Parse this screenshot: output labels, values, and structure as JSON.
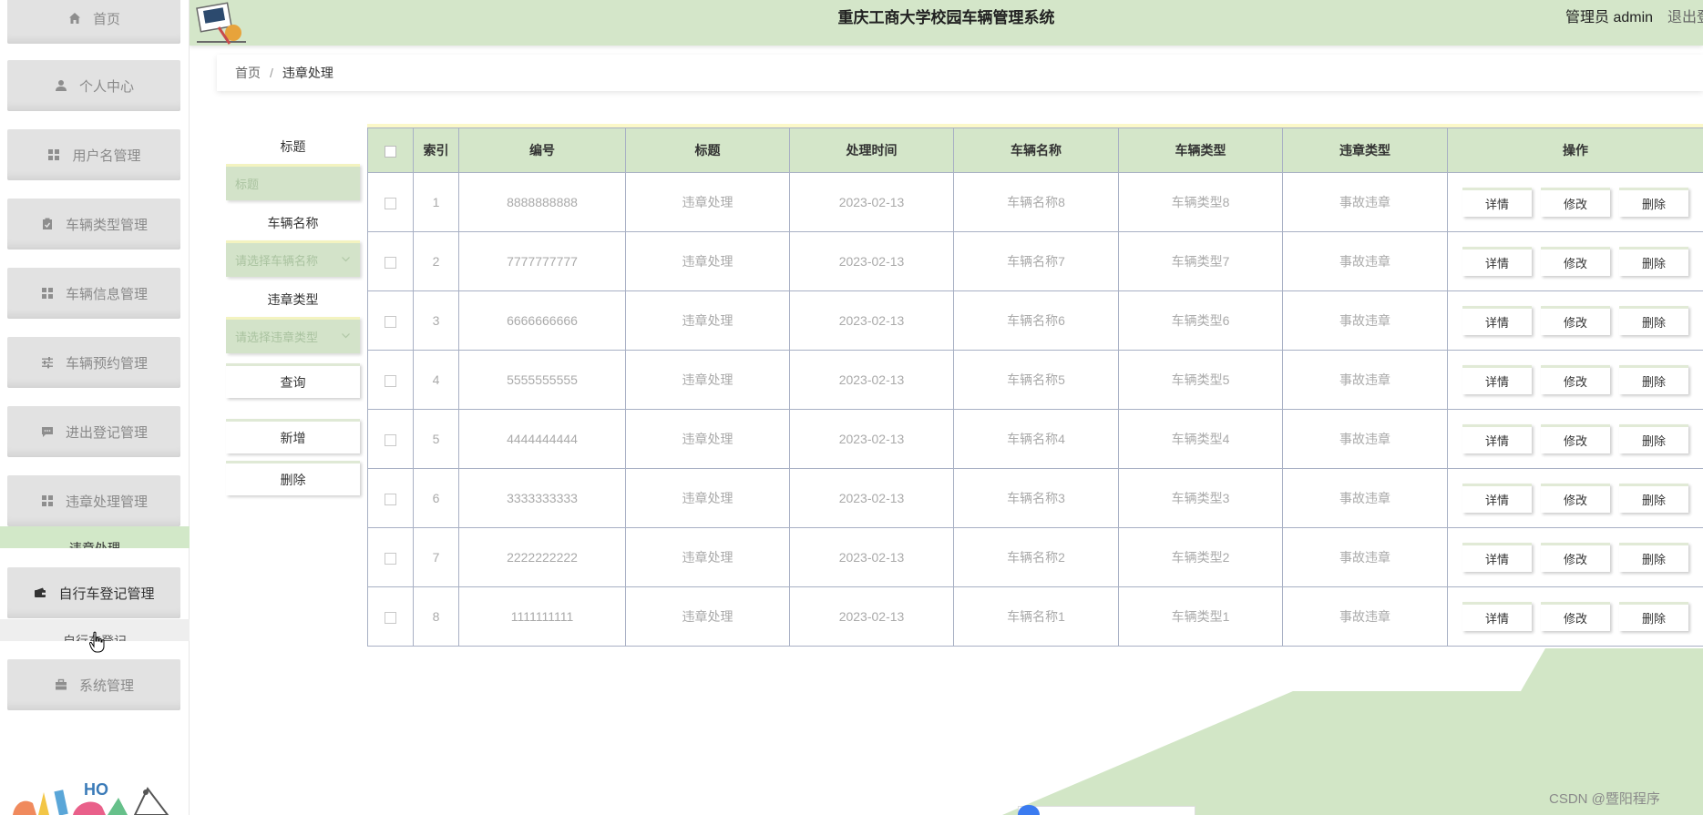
{
  "app": {
    "title": "重庆工商大学校园车辆管理系统",
    "user": "管理员 admin",
    "logout": "退出登"
  },
  "sidebar": {
    "items": [
      {
        "label": "首页",
        "icon": "home-icon"
      },
      {
        "label": "个人中心",
        "icon": "person-icon"
      },
      {
        "label": "用户名管理",
        "icon": "grid-icon"
      },
      {
        "label": "车辆类型管理",
        "icon": "clipboard-icon"
      },
      {
        "label": "车辆信息管理",
        "icon": "grid-icon"
      },
      {
        "label": "车辆预约管理",
        "icon": "sliders-icon"
      },
      {
        "label": "进出登记管理",
        "icon": "chat-icon"
      },
      {
        "label": "违章处理管理",
        "icon": "grid-icon"
      },
      {
        "label": "自行车登记管理",
        "icon": "wallet-icon"
      },
      {
        "label": "系统管理",
        "icon": "briefcase-icon"
      }
    ],
    "subitems": [
      {
        "label": "违章处理"
      },
      {
        "label": "自行车登记"
      }
    ]
  },
  "breadcrumb": {
    "home": "首页",
    "separator": "/",
    "current": "违章处理"
  },
  "search": {
    "title_label": "标题",
    "title_placeholder": "标题",
    "vehicle_name_label": "车辆名称",
    "vehicle_name_placeholder": "请选择车辆名称",
    "violation_type_label": "违章类型",
    "violation_type_placeholder": "请选择违章类型",
    "query_button": "查询",
    "add_button": "新增",
    "delete_button": "删除"
  },
  "table": {
    "columns": [
      "索引",
      "编号",
      "标题",
      "处理时间",
      "车辆名称",
      "车辆类型",
      "违章类型",
      "操作"
    ],
    "rows": [
      {
        "index": "1",
        "number": "8888888888",
        "title": "违章处理",
        "time": "2023-02-13",
        "vehicle_name": "车辆名称8",
        "vehicle_type": "车辆类型8",
        "violation_type": "事故违章"
      },
      {
        "index": "2",
        "number": "7777777777",
        "title": "违章处理",
        "time": "2023-02-13",
        "vehicle_name": "车辆名称7",
        "vehicle_type": "车辆类型7",
        "violation_type": "事故违章"
      },
      {
        "index": "3",
        "number": "6666666666",
        "title": "违章处理",
        "time": "2023-02-13",
        "vehicle_name": "车辆名称6",
        "vehicle_type": "车辆类型6",
        "violation_type": "事故违章"
      },
      {
        "index": "4",
        "number": "5555555555",
        "title": "违章处理",
        "time": "2023-02-13",
        "vehicle_name": "车辆名称5",
        "vehicle_type": "车辆类型5",
        "violation_type": "事故违章"
      },
      {
        "index": "5",
        "number": "4444444444",
        "title": "违章处理",
        "time": "2023-02-13",
        "vehicle_name": "车辆名称4",
        "vehicle_type": "车辆类型4",
        "violation_type": "事故违章"
      },
      {
        "index": "6",
        "number": "3333333333",
        "title": "违章处理",
        "time": "2023-02-13",
        "vehicle_name": "车辆名称3",
        "vehicle_type": "车辆类型3",
        "violation_type": "事故违章"
      },
      {
        "index": "7",
        "number": "2222222222",
        "title": "违章处理",
        "time": "2023-02-13",
        "vehicle_name": "车辆名称2",
        "vehicle_type": "车辆类型2",
        "violation_type": "事故违章"
      },
      {
        "index": "8",
        "number": "1111111111",
        "title": "违章处理",
        "time": "2023-02-13",
        "vehicle_name": "车辆名称1",
        "vehicle_type": "车辆类型1",
        "violation_type": "事故违章"
      }
    ],
    "actions": {
      "detail": "详情",
      "edit": "修改",
      "delete": "删除"
    }
  },
  "watermark": "CSDN @暨阳程序",
  "colors": {
    "primary_green": "#d4e6c9",
    "sidebar_item": "#e2e2e2",
    "accent_yellow": "#fbf8c8",
    "border": "#a8b0c4"
  }
}
